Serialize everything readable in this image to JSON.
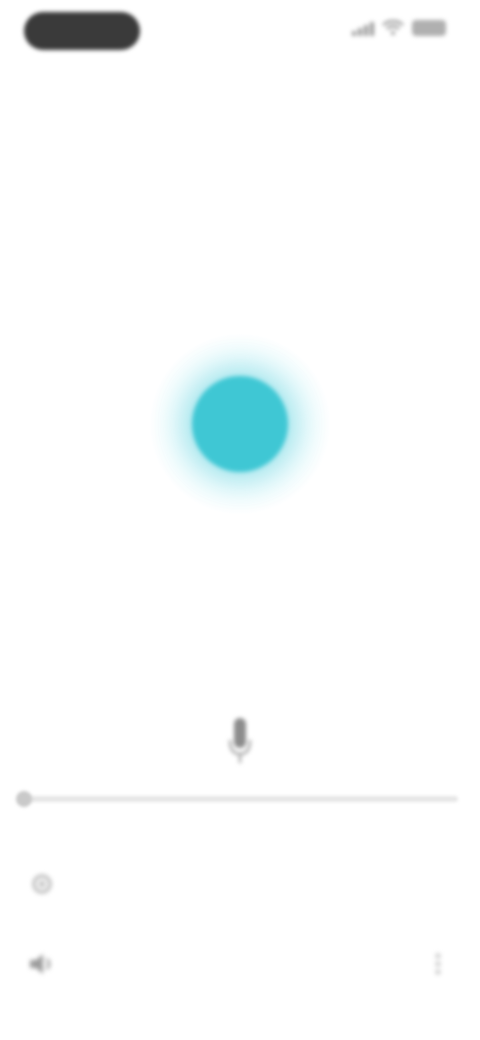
{
  "status_bar": {
    "time": "",
    "pill_color": "#3a3a3a"
  },
  "header": {
    "title": ""
  },
  "orb": {
    "color": "#3fc7d4",
    "glow_color": "#aaecf4"
  },
  "player": {
    "progress": 0.0,
    "elapsed": "",
    "total": ""
  },
  "icons": {
    "mic": "microphone-icon",
    "left_top": "settings-icon",
    "left_bottom": "sound-icon",
    "right_bottom": "more-icon"
  }
}
